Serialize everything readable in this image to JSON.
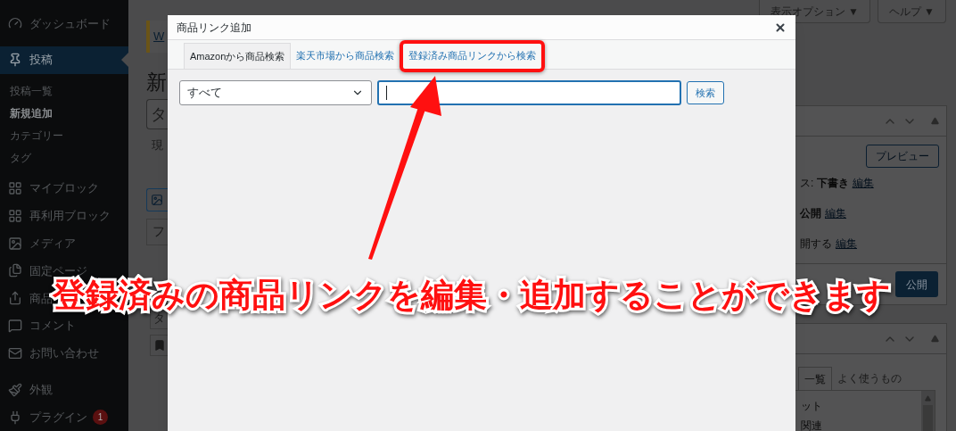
{
  "sidebar": {
    "items": [
      {
        "label": "ダッシュボード",
        "selected": false
      },
      {
        "label": "投稿",
        "selected": true,
        "children": [
          {
            "label": "投稿一覧",
            "selected": false
          },
          {
            "label": "新規追加",
            "selected": true
          },
          {
            "label": "カテゴリー",
            "selected": false
          },
          {
            "label": "タグ",
            "selected": false
          }
        ]
      },
      {
        "label": "マイブロック",
        "selected": false
      },
      {
        "label": "再利用ブロック",
        "selected": false
      },
      {
        "label": "メディア",
        "selected": false
      },
      {
        "label": "固定ページ",
        "selected": false
      },
      {
        "label": "商品",
        "selected": false
      },
      {
        "label": "コメント",
        "selected": false
      },
      {
        "label": "お問い合わせ",
        "selected": false
      },
      {
        "label": "外観",
        "selected": false
      },
      {
        "label": "プラグイン",
        "selected": false,
        "badge": "1"
      }
    ]
  },
  "top_buttons": [
    "表示オプション ▼",
    "ヘルプ ▼"
  ],
  "editor": {
    "notice_link": "W",
    "heading": "新",
    "title_field": "タ",
    "note": "現",
    "panel_row": "フ",
    "row_field": "タ"
  },
  "publish_box": {
    "preview_button": "プレビュー",
    "lines": [
      {
        "text": "ス: **下書き**",
        "link": "編集"
      },
      {
        "text": "**公開**",
        "link": "編集"
      },
      {
        "text": "開する",
        "link": "編集"
      }
    ],
    "publish_button": "公開"
  },
  "category_box": {
    "tabs": [
      {
        "label": "一覧",
        "selected": true
      },
      {
        "label": "よく使うもの",
        "selected": false
      }
    ],
    "items": [
      "ット",
      "関連"
    ]
  },
  "modal": {
    "title": "商品リンク追加",
    "tabs": [
      {
        "label": "Amazonから商品検索",
        "selected": true,
        "highlighted": false
      },
      {
        "label": "楽天市場から商品検索",
        "selected": false,
        "highlighted": false
      },
      {
        "label": "登録済み商品リンクから検索",
        "selected": false,
        "highlighted": true
      }
    ],
    "select_value": "すべて",
    "search_focused": true,
    "search_button": "検索"
  },
  "annotation": {
    "text": "登録済みの商品リンクを編集・追加することができます"
  }
}
